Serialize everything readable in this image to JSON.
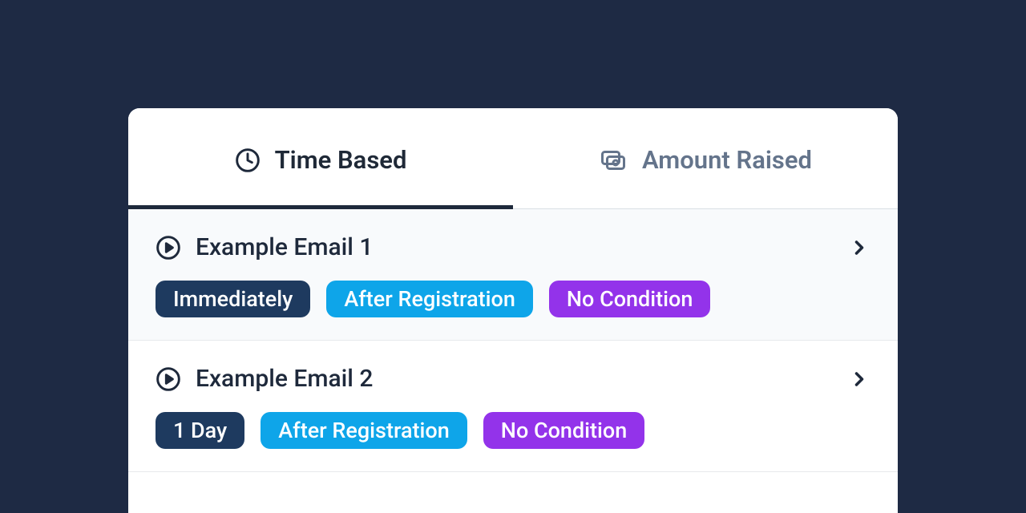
{
  "tabs": [
    {
      "label": "Time Based",
      "active": true
    },
    {
      "label": "Amount Raised",
      "active": false
    }
  ],
  "emails": [
    {
      "title": "Example Email 1",
      "badges": [
        {
          "label": "Immediately",
          "variant": "navy"
        },
        {
          "label": "After Registration",
          "variant": "blue"
        },
        {
          "label": "No Condition",
          "variant": "purple"
        }
      ]
    },
    {
      "title": "Example Email 2",
      "badges": [
        {
          "label": "1 Day",
          "variant": "navy"
        },
        {
          "label": "After Registration",
          "variant": "blue"
        },
        {
          "label": "No Condition",
          "variant": "purple"
        }
      ]
    }
  ],
  "colors": {
    "background": "#1e2a44",
    "navy": "#1e3a5f",
    "blue": "#0ea5e9",
    "purple": "#9333ea"
  }
}
